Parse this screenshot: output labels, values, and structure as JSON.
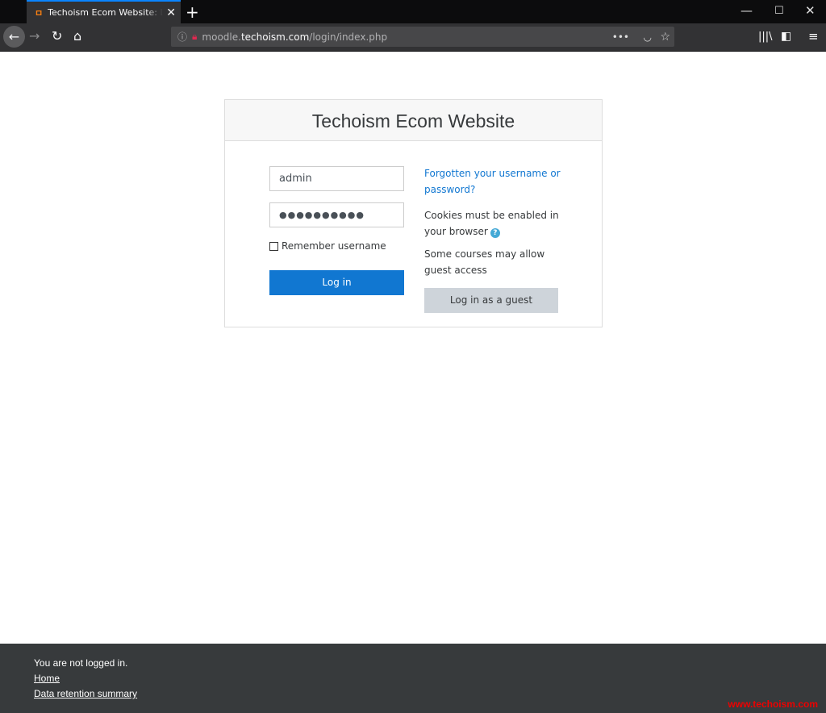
{
  "browser": {
    "tab_title": "Techoism Ecom Website: Log in to the site",
    "favicon": "moodle-m-icon",
    "url_host": "techoism.com",
    "url_prefix": "moodle.",
    "url_path": "/login/index.php"
  },
  "card": {
    "title": "Techoism Ecom Website"
  },
  "login": {
    "username_value": "admin",
    "password_masked": "●●●●●●●●●●",
    "remember_label": "Remember username",
    "remember_checked": false,
    "login_button": "Log in"
  },
  "side": {
    "forgot_link": "Forgotten your username or password?",
    "cookies_text": "Cookies must be enabled in your browser",
    "guest_text": "Some courses may allow guest access",
    "guest_button": "Log in as a guest"
  },
  "footer": {
    "status": "You are not logged in.",
    "home_link": "Home",
    "data_link": "Data retention summary",
    "watermark": "www.techoism.com"
  },
  "colors": {
    "primary": "#1177d1",
    "footer_bg": "#373a3c",
    "tab_accent": "#0a84ff"
  }
}
